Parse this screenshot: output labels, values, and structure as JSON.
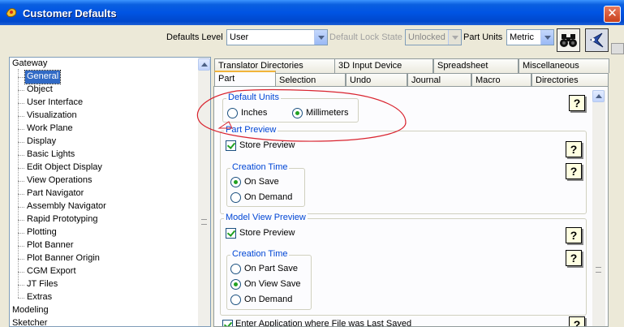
{
  "window": {
    "title": "Customer Defaults",
    "close_glyph": "✕"
  },
  "toolbar": {
    "defaults_level_label": "Defaults Level",
    "defaults_level_value": "User",
    "lock_state_label": "Default Lock State",
    "lock_state_value": "Unlocked",
    "part_units_label": "Part Units",
    "part_units_value": "Metric"
  },
  "tree": {
    "items": [
      "Gateway",
      "General",
      "Object",
      "User Interface",
      "Visualization",
      "Work Plane",
      "Display",
      "Basic Lights",
      "Edit Object Display",
      "View Operations",
      "Part Navigator",
      "Assembly Navigator",
      "Rapid Prototyping",
      "Plotting",
      "Plot Banner",
      "Plot Banner Origin",
      "CGM Export",
      "JT Files",
      "Extras",
      "Modeling",
      "Sketcher"
    ],
    "selected": "General"
  },
  "tabs": {
    "row1": [
      "Translator Directories",
      "3D Input Device",
      "Spreadsheet",
      "Miscellaneous"
    ],
    "row2": [
      "Part",
      "Selection",
      "Undo",
      "Journal",
      "Macro",
      "Directories"
    ],
    "active": "Part"
  },
  "panel": {
    "default_units": {
      "title": "Default Units",
      "options": [
        "Inches",
        "Millimeters"
      ],
      "selected": "Millimeters"
    },
    "part_preview": {
      "title": "Part Preview",
      "store_preview": "Store Preview",
      "store_checked": true,
      "creation_time": {
        "title": "Creation Time",
        "options": [
          "On Save",
          "On Demand"
        ],
        "selected": "On Save"
      }
    },
    "model_view_preview": {
      "title": "Model View Preview",
      "store_preview": "Store Preview",
      "store_checked": true,
      "creation_time": {
        "title": "Creation Time",
        "options": [
          "On Part Save",
          "On View Save",
          "On Demand"
        ],
        "selected": "On View Save"
      }
    },
    "enter_application": {
      "label": "Enter Application where File was Last Saved",
      "checked": true
    },
    "help_glyph": "?"
  },
  "colors": {
    "titlebar": "#0054e3",
    "selection": "#316ac5",
    "group_title": "#0046d5",
    "annotation": "#d9232e"
  }
}
